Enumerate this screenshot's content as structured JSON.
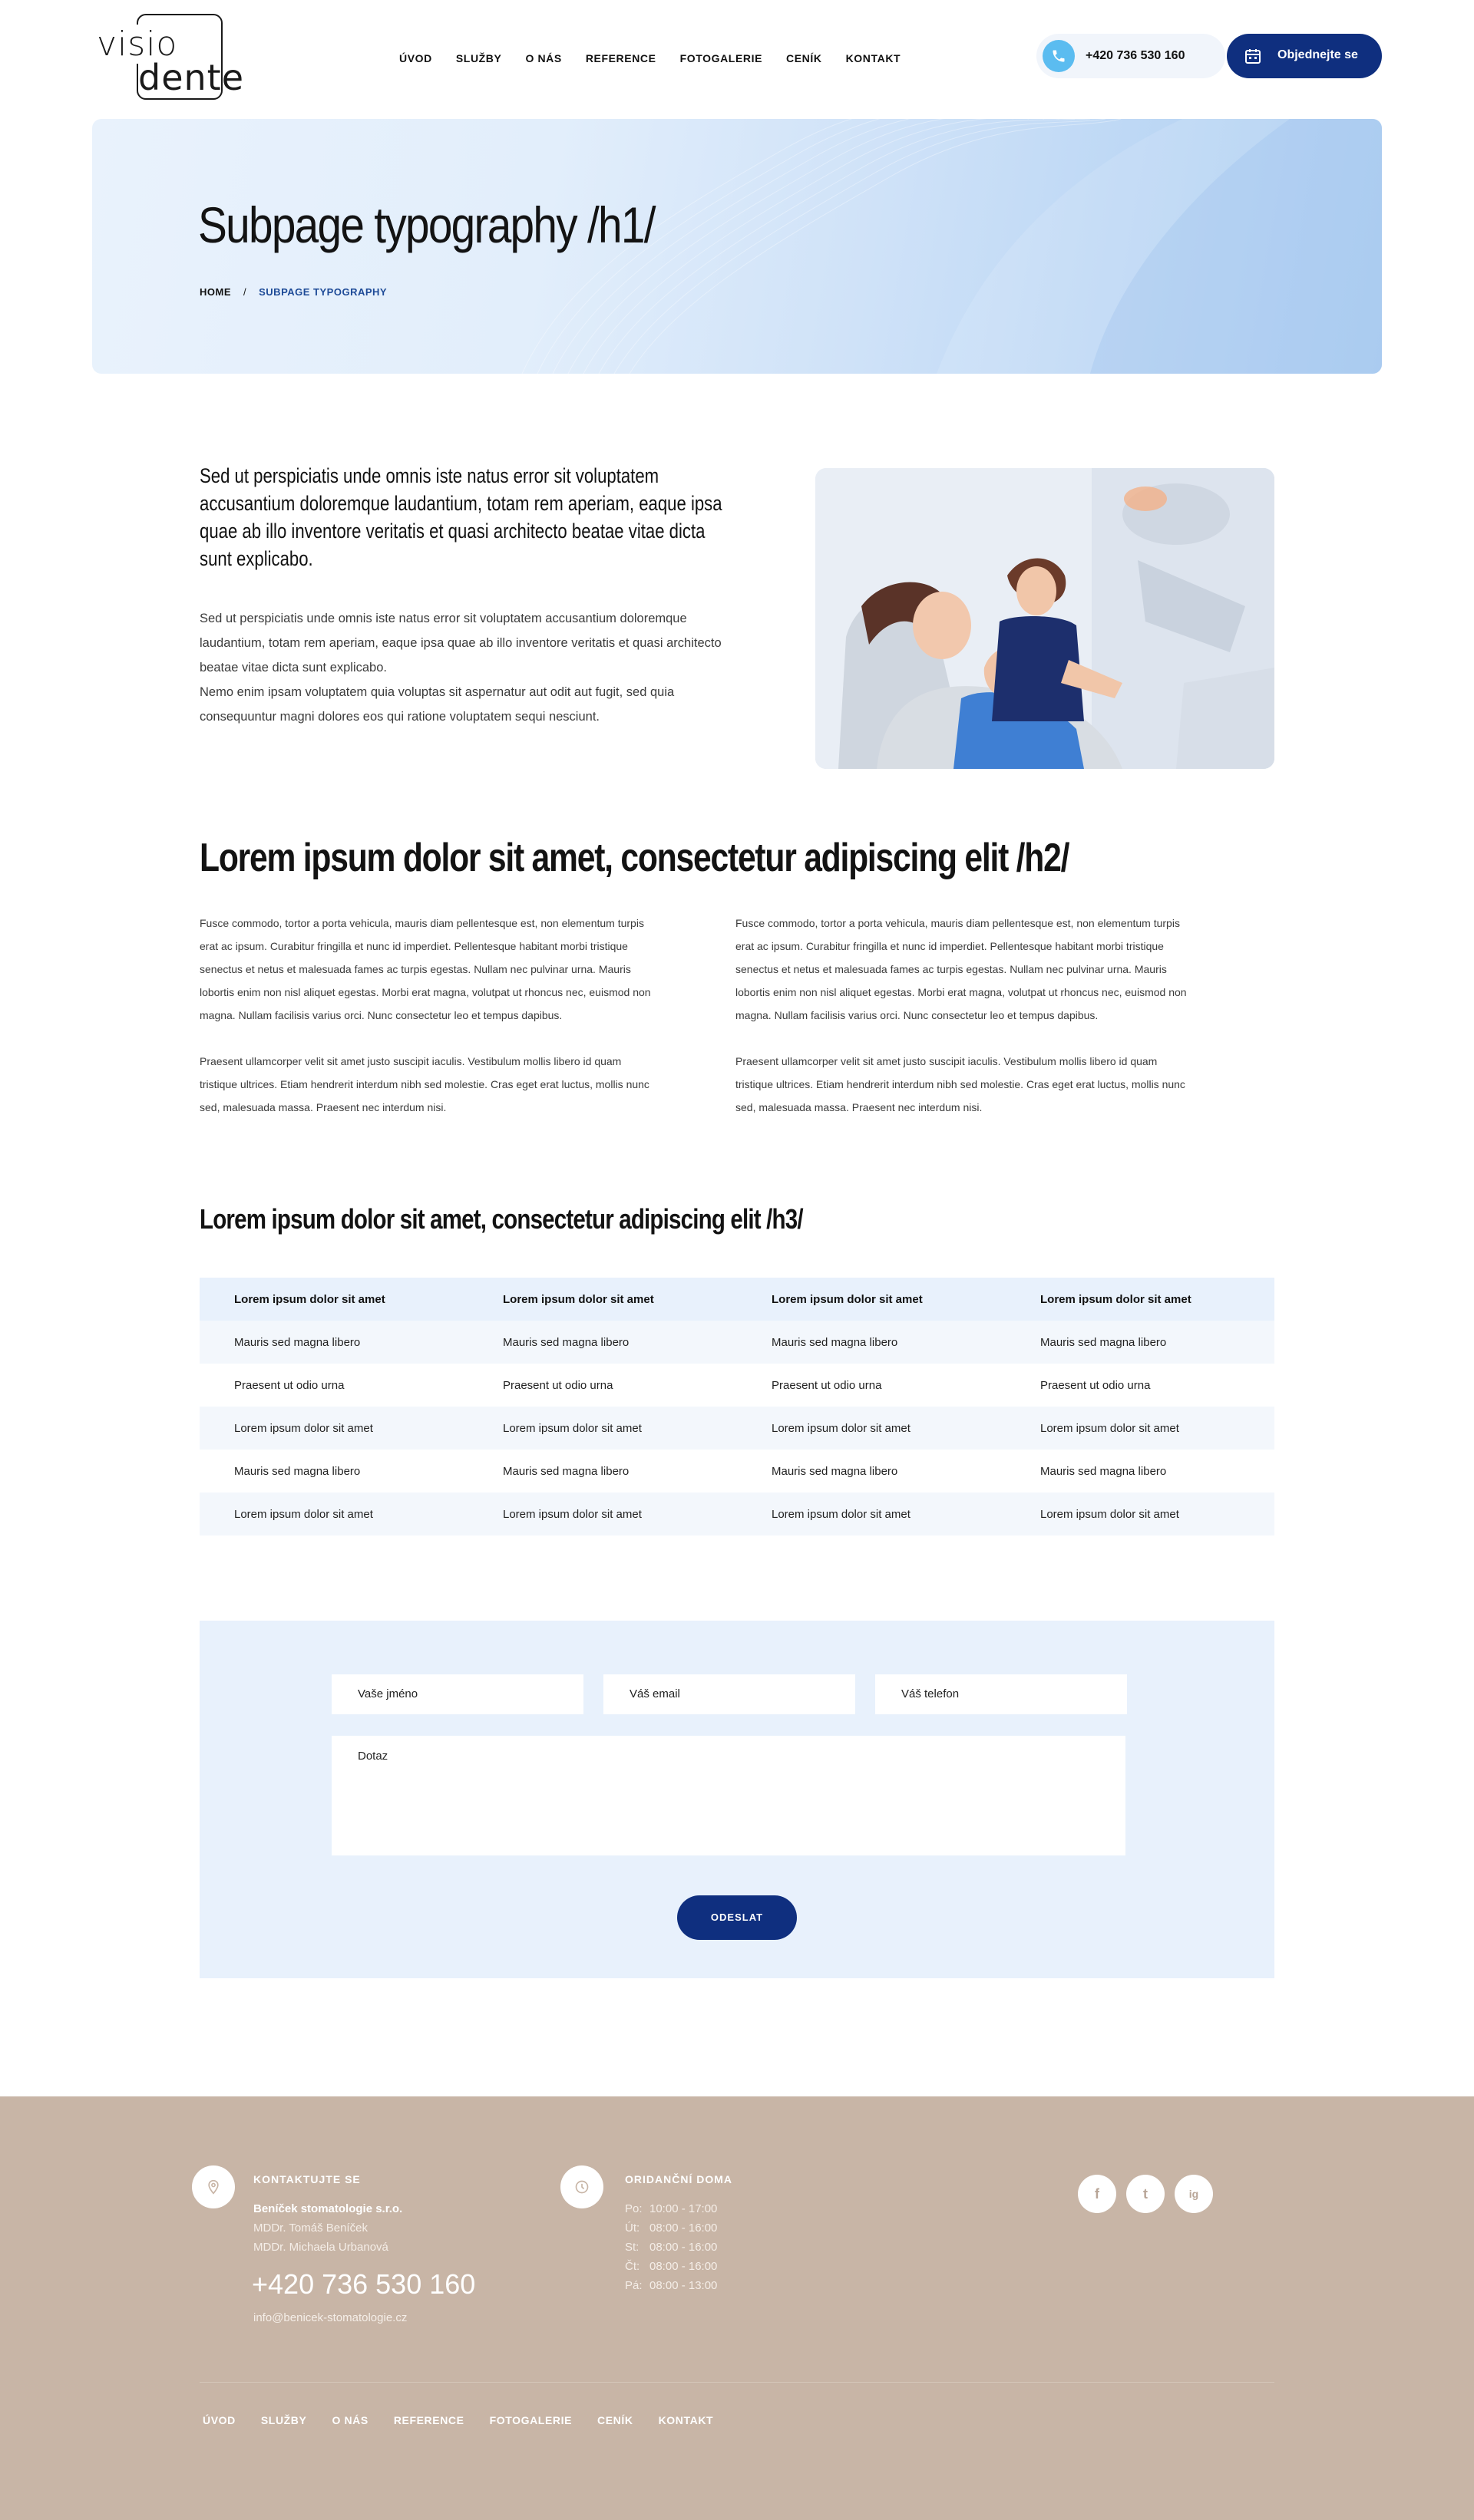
{
  "logo": {
    "line1": "visio",
    "line2": "dente"
  },
  "nav": [
    "ÚVOD",
    "SLUŽBY",
    "O NÁS",
    "REFERENCE",
    "FOTOGALERIE",
    "CENÍK",
    "KONTAKT"
  ],
  "header": {
    "phone": "+420 736 530 160",
    "book_label": "Objednejte se"
  },
  "hero": {
    "title": "Subpage typography /h1/",
    "breadcrumb_home": "HOME",
    "breadcrumb_sep": "/",
    "breadcrumb_current": "SUBPAGE TYPOGRAPHY"
  },
  "intro": {
    "lead": "Sed ut perspiciatis unde omnis iste natus error sit voluptatem accusantium doloremque laudantium, totam rem aperiam, eaque ipsa quae ab illo inventore veritatis et quasi architecto beatae vitae dicta sunt explicabo.",
    "para1": "Sed ut perspiciatis unde omnis iste natus error sit voluptatem accusantium doloremque laudantium, totam rem aperiam, eaque ipsa quae ab illo inventore veritatis et quasi architecto beatae vitae dicta sunt explicabo.",
    "para2": "Nemo enim ipsam voluptatem quia voluptas sit aspernatur aut odit aut fugit, sed quia consequuntur magni dolores eos qui ratione voluptatem sequi nesciunt."
  },
  "section2": {
    "title": "Lorem ipsum dolor sit amet, consectetur adipiscing elit /h2/",
    "col_p1": "Fusce commodo, tortor a porta vehicula, mauris diam pellentesque est, non elementum turpis erat ac ipsum. Curabitur fringilla et nunc id imperdiet. Pellentesque habitant morbi tristique senectus et netus et malesuada fames ac turpis egestas. Nullam nec pulvinar urna. Mauris lobortis enim non nisl aliquet egestas. Morbi erat magna, volutpat ut rhoncus nec, euismod non magna. Nullam facilisis varius orci. Nunc consectetur leo et tempus dapibus.",
    "col_p2": "Praesent ullamcorper velit sit amet justo suscipit iaculis. Vestibulum mollis libero id quam tristique ultrices. Etiam hendrerit interdum nibh sed molestie. Cras eget erat luctus, mollis nunc sed, malesuada massa. Praesent nec interdum nisi."
  },
  "section3": {
    "title": "Lorem ipsum dolor sit amet, consectetur adipiscing elit /h3/"
  },
  "table": {
    "headers": [
      "Lorem ipsum dolor sit amet",
      "Lorem ipsum dolor sit amet",
      "Lorem ipsum dolor sit amet",
      "Lorem ipsum dolor sit amet"
    ],
    "rows": [
      [
        "Mauris sed magna libero",
        "Mauris sed magna libero",
        "Mauris sed magna libero",
        "Mauris sed magna libero"
      ],
      [
        "Praesent ut odio urna",
        "Praesent ut odio urna",
        "Praesent ut odio urna",
        "Praesent ut odio urna"
      ],
      [
        "Lorem ipsum dolor sit amet",
        "Lorem ipsum dolor sit amet",
        "Lorem ipsum dolor sit amet",
        "Lorem ipsum dolor sit amet"
      ],
      [
        "Mauris sed magna libero",
        "Mauris sed magna libero",
        "Mauris sed magna libero",
        "Mauris sed magna libero"
      ],
      [
        "Lorem ipsum dolor sit amet",
        "Lorem ipsum dolor sit amet",
        "Lorem ipsum dolor sit amet",
        "Lorem ipsum dolor sit amet"
      ]
    ]
  },
  "form": {
    "name_placeholder": "Vaše jméno",
    "email_placeholder": "Váš email",
    "phone_placeholder": "Váš telefon",
    "query_placeholder": "Dotaz",
    "submit_label": "ODESLAT"
  },
  "footer": {
    "contact_heading": "KONTAKTUJTE SE",
    "company": "Beníček stomatologie s.r.o.",
    "doctor1": "MDDr. Tomáš Beníček",
    "doctor2": "MDDr. Michaela Urbanová",
    "phone": "+420 736 530 160",
    "email": "info@benicek-stomatologie.cz",
    "hours_heading": "ORIDANČNÍ DOMA",
    "hours": [
      {
        "day": "Po:",
        "time": "10:00 - 17:00"
      },
      {
        "day": "Út:",
        "time": "08:00 - 16:00"
      },
      {
        "day": "St:",
        "time": "08:00 - 16:00"
      },
      {
        "day": "Čt:",
        "time": "08:00 - 16:00"
      },
      {
        "day": "Pá:",
        "time": "08:00 - 13:00"
      }
    ],
    "social": {
      "facebook": "f",
      "twitter": "t",
      "instagram": "ig"
    },
    "nav": [
      "ÚVOD",
      "SLUŽBY",
      "O NÁS",
      "REFERENCE",
      "FOTOGALERIE",
      "CENÍK",
      "KONTAKT"
    ]
  },
  "colors": {
    "primary": "#0f2f7f",
    "accent": "#5bbcf0",
    "hero_light": "#e9f2fc",
    "footer_bg": "#c8b5a6"
  }
}
